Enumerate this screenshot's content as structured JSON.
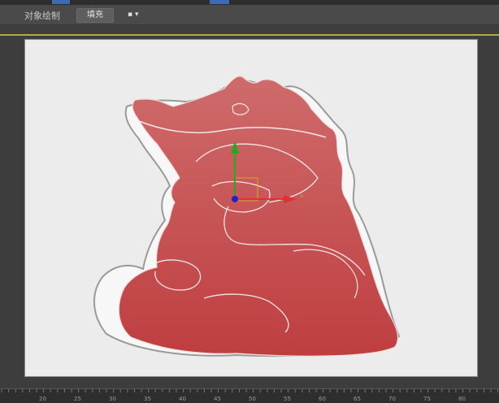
{
  "ribbon": {
    "tab_label": "对象绘制",
    "fill_button": "填充",
    "viewport_dropdown": "▪ ▾"
  },
  "ruler": {
    "labels": [
      "20",
      "25",
      "30",
      "35",
      "40",
      "45",
      "50",
      "55",
      "60",
      "65",
      "70",
      "75",
      "80"
    ]
  },
  "colors": {
    "fill_red": "#c0474a",
    "gizmo_x": "#e03030",
    "gizmo_y": "#22aa22",
    "gizmo_center": "#2020d0",
    "ribbon_bg": "#4a4a4a",
    "canvas_bg": "#ececec"
  },
  "icons": {
    "gizmo": "move-transform-gizmo-icon"
  }
}
